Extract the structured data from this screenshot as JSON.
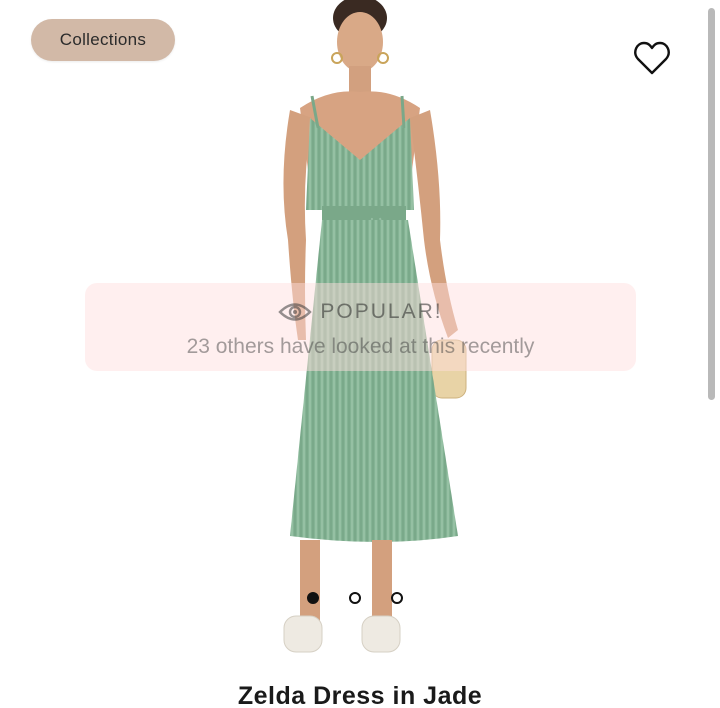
{
  "header": {
    "collections_label": "Collections"
  },
  "icons": {
    "wishlist": "heart-outline-icon",
    "popular": "eye-icon"
  },
  "popular_banner": {
    "title": "POPULAR!",
    "subtitle": "23 others have looked at this recently"
  },
  "carousel": {
    "total": 3,
    "active_index": 0
  },
  "product": {
    "title": "Zelda Dress in Jade"
  },
  "colors": {
    "accent_button": "#d2b9a7",
    "dress": "#7fae8e",
    "banner": "#ffe3e3"
  }
}
